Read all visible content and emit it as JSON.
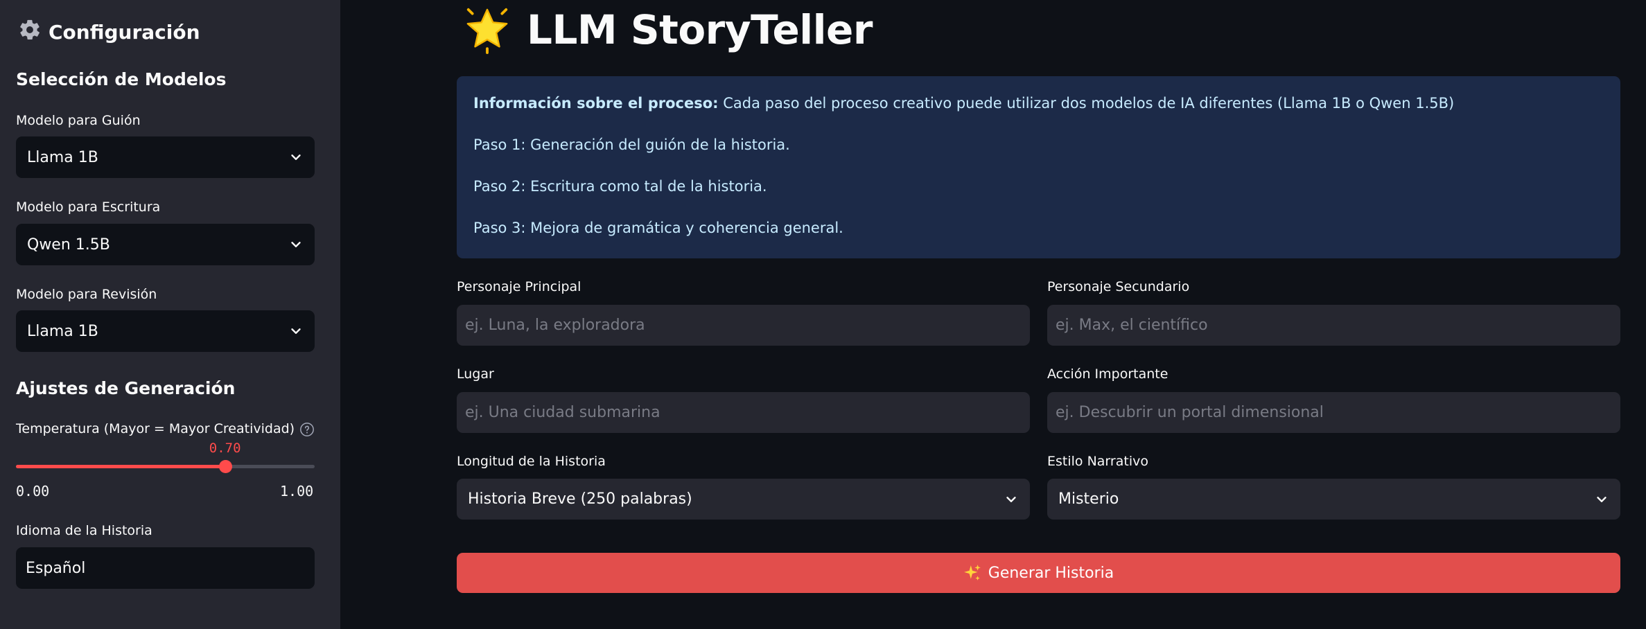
{
  "sidebar": {
    "title": "Configuración",
    "models_heading": "Selección de Modelos",
    "script_model": {
      "label": "Modelo para Guión",
      "value": "Llama 1B"
    },
    "writing_model": {
      "label": "Modelo para Escritura",
      "value": "Qwen 1.5B"
    },
    "review_model": {
      "label": "Modelo para Revisión",
      "value": "Llama 1B"
    },
    "generation_heading": "Ajustes de Generación",
    "temperature": {
      "label": "Temperatura (Mayor = Mayor Creatividad)",
      "value": 0.7,
      "value_text": "0.70",
      "min": 0,
      "max": 1,
      "min_text": "0.00",
      "max_text": "1.00"
    },
    "language": {
      "label": "Idioma de la Historia",
      "value": "Español"
    }
  },
  "main": {
    "title": "LLM StoryTeller",
    "info": {
      "bold": "Información sobre el proceso:",
      "intro": " Cada paso del proceso creativo puede utilizar dos modelos de IA diferentes (Llama 1B o Qwen 1.5B)",
      "step1": "Paso 1: Generación del guión de la historia.",
      "step2": "Paso 2: Escritura como tal de la historia.",
      "step3": "Paso 3: Mejora de gramática y coherencia general."
    },
    "fields": {
      "main_character": {
        "label": "Personaje Principal",
        "placeholder": "ej. Luna, la exploradora"
      },
      "secondary_character": {
        "label": "Personaje Secundario",
        "placeholder": "ej. Max, el científico"
      },
      "place": {
        "label": "Lugar",
        "placeholder": "ej. Una ciudad submarina"
      },
      "action": {
        "label": "Acción Importante",
        "placeholder": "ej. Descubrir un portal dimensional"
      },
      "length": {
        "label": "Longitud de la Historia",
        "value": "Historia Breve (250 palabras)"
      },
      "style": {
        "label": "Estilo Narrativo",
        "value": "Misterio"
      }
    },
    "generate_button": "Generar Historia"
  },
  "colors": {
    "background": "#0e1117",
    "sidebar": "#262730",
    "accent": "#ff4b4b",
    "button": "#e24e4c",
    "info_bg": "#1c2a48",
    "info_text": "#c7ebff"
  },
  "icons": {
    "sidebar_title": "gear-icon",
    "page_title": "star-icon",
    "button": "sparkles-icon",
    "select": "chevron-down-icon",
    "help": "help-circle-icon"
  }
}
